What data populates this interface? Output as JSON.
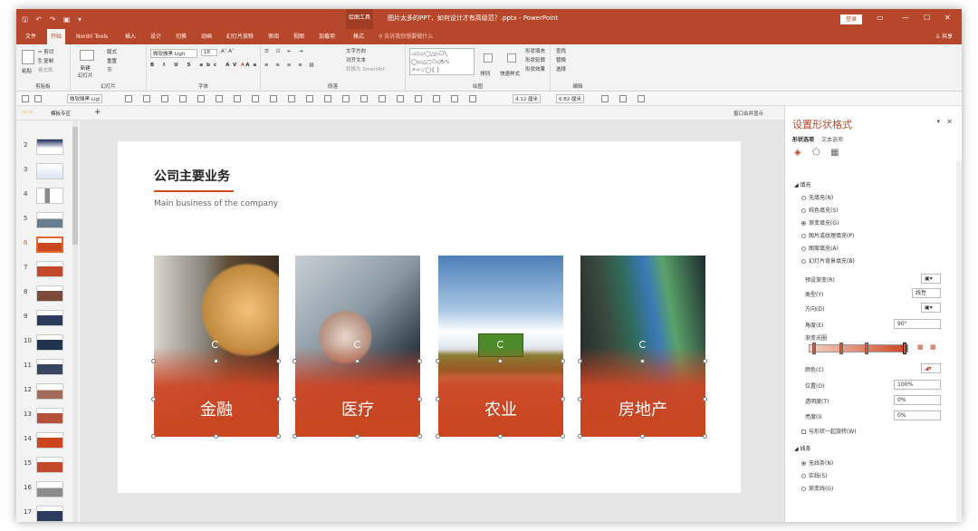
{
  "window": {
    "title": "图片太多的PPT，如何设计才有高级范？.pptx - PowerPoint",
    "drawing_tools": "绘图工具",
    "login": "登录",
    "quick_access": "🖫 ↶ ↷ ▣ ▾"
  },
  "tabs": [
    "文件",
    "开始",
    "Nordri Tools",
    "插入",
    "设计",
    "切换",
    "动画",
    "幻灯片放映",
    "审阅",
    "视图",
    "加载项",
    "格式"
  ],
  "tell_me": "⚲ 告诉我你想要做什么",
  "share": "♙ 共享",
  "ribbon": {
    "groups": [
      {
        "label": "剪贴板"
      },
      {
        "label": "幻灯片"
      },
      {
        "label": "字体"
      },
      {
        "label": "段落"
      },
      {
        "label": "绘图"
      },
      {
        "label": "编辑"
      }
    ],
    "paste": "粘贴",
    "cut": "✂ 剪切",
    "copy": "⎘ 复制",
    "format_painter": "格式刷",
    "new_slide": "新建\n幻灯片",
    "layout": "版式",
    "reset": "重置",
    "section": "节",
    "font": "微软雅黑 Ligh",
    "size": "18",
    "text_dir": "文字方向",
    "align_text": "对齐文本",
    "smartart": "转换为 SmartArt",
    "arrange": "排列",
    "quick_styles": "快速样式",
    "fill": "形状填充",
    "outline": "形状轮廓",
    "effect": "形状效果",
    "find": "查找",
    "replace": "替换",
    "select": "选择"
  },
  "toolbar2": {
    "font": "微软雅黑 Ligl",
    "width": "4.12 厘米",
    "height": "6.82 厘米"
  },
  "tabstrip": {
    "label": "模板专区",
    "merge": "窗口合并显示"
  },
  "thumbs": [
    "2",
    "3",
    "4",
    "5",
    "6",
    "7",
    "8",
    "9",
    "10",
    "11",
    "12",
    "13",
    "14",
    "15",
    "16",
    "17"
  ],
  "slide": {
    "title": "公司主要业务",
    "subtitle": "Main business of the company",
    "cards": [
      {
        "label": "金融"
      },
      {
        "label": "医疗"
      },
      {
        "label": "农业"
      },
      {
        "label": "房地产"
      }
    ]
  },
  "pane": {
    "title": "设置形状格式",
    "tab_shape": "形状选项",
    "tab_text": "文本选项",
    "fill_section": "◢ 填充",
    "fill_options": [
      "无填充(N)",
      "纯色填充(S)",
      "渐变填充(G)",
      "图片或纹理填充(P)",
      "图案填充(A)",
      "幻灯片背景填充(B)"
    ],
    "preset": "预设渐变(R)",
    "type": "类型(Y)",
    "type_val": "线性",
    "direction": "方向(D)",
    "angle": "角度(E)",
    "angle_val": "90°",
    "stops": "渐变光圈",
    "color": "颜色(C)",
    "position": "位置(O)",
    "position_val": "100%",
    "transparency": "透明度(T)",
    "transparency_val": "0%",
    "brightness": "亮度(I)",
    "brightness_val": "0%",
    "rotate": "与形状一起旋转(W)",
    "line_section": "◢ 线条",
    "line_options": [
      "无线条(N)",
      "实线(S)",
      "渐变线(G)"
    ]
  }
}
